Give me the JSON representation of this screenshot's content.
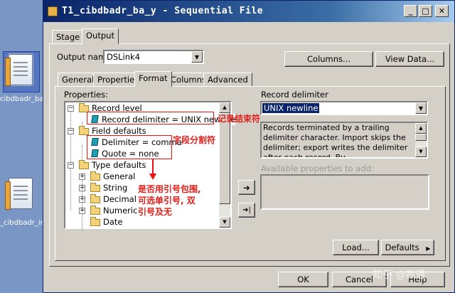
{
  "desktop": {
    "icons": [
      {
        "label": "cibdbadr_ba"
      },
      {
        "label": "_cibdbadr_in"
      }
    ]
  },
  "window": {
    "title": "T1_cibdbadr_ba_y - Sequential File",
    "controls": {
      "minimize": "_",
      "maximize": "□",
      "close": "✕"
    }
  },
  "top_tabs": [
    {
      "label": "Stage"
    },
    {
      "label": "Output"
    }
  ],
  "output_name": {
    "label": "Output name:",
    "value": "DSLink4"
  },
  "buttons": {
    "columns": "Columns...",
    "view_data": "View Data...",
    "load": "Load...",
    "defaults": "Defaults",
    "ok": "OK",
    "cancel": "Cancel",
    "help": "Help"
  },
  "inner_tabs": [
    {
      "label": "General"
    },
    {
      "label": "Properties"
    },
    {
      "label": "Format"
    },
    {
      "label": "Columns"
    },
    {
      "label": "Advanced"
    }
  ],
  "properties": {
    "label": "Properties:",
    "tree": [
      {
        "text": "Record level"
      },
      {
        "text": "Record delimiter = UNIX newline"
      },
      {
        "text": "Field defaults"
      },
      {
        "text": "Delimiter = comma"
      },
      {
        "text": "Quote = none"
      },
      {
        "text": "Type defaults"
      },
      {
        "text": "General"
      },
      {
        "text": "String"
      },
      {
        "text": "Decimal"
      },
      {
        "text": "Numeric"
      },
      {
        "text": "Date"
      }
    ]
  },
  "record_delimiter": {
    "label": "Record delimiter",
    "value": "UNIX newline",
    "description": "Records terminated by a trailing delimiter character. Import skips the delimiter; export writes the delimiter after each record. By"
  },
  "available": {
    "label": "Available properties to add:"
  },
  "move_buttons": {
    "add": "➜",
    "add_all": "➜|"
  },
  "annotations": {
    "record_delim": "记录结束符",
    "field_delim": "字段分割符",
    "quote_note": "是否用引号包围, 可选单引号, 双引号及无"
  },
  "watermark": "知乎 @数道"
}
